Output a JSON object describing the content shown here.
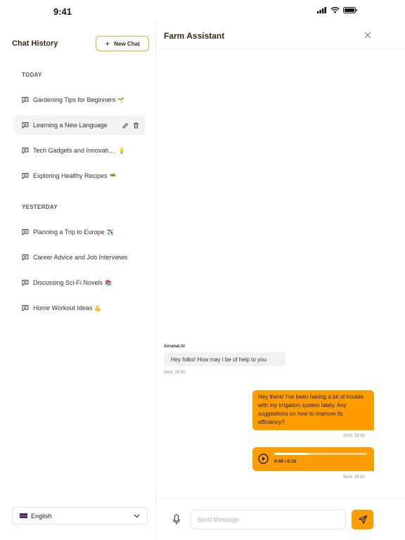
{
  "status_bar": {
    "time": "9:41"
  },
  "sidebar": {
    "title": "Chat History",
    "new_chat_label": "New Chat",
    "sections": [
      {
        "label": "TODAY",
        "items": [
          {
            "label": "Gardening Tips for Beginners",
            "emoji": "🌱"
          },
          {
            "label": "Learning a New Language",
            "emoji": ""
          },
          {
            "label": "Tech Gadgets and Innovations",
            "emoji": "💡"
          },
          {
            "label": "Exploring Healthy Recipes",
            "emoji": "🥗"
          }
        ]
      },
      {
        "label": "YESTERDAY",
        "items": [
          {
            "label": "Planning a Trip to Europe",
            "emoji": "✈️"
          },
          {
            "label": "Career Advice and Job Interviews",
            "emoji": ""
          },
          {
            "label": "Discussing Sci-Fi Novels",
            "emoji": "📚"
          },
          {
            "label": "Home Workout Ideas",
            "emoji": "💪"
          }
        ]
      }
    ],
    "language": "English"
  },
  "chat": {
    "title": "Farm Assistant",
    "messages": [
      {
        "sender": "Airsmat AI",
        "text": "Hey folks! How may i be of help to you",
        "sent": "Sent: 19:30"
      },
      {
        "text": "Hey there! I've been having a bit of trouble with my irrigation system lately. Any suggestions on how to improve its efficiency?",
        "sent": "Sent: 19:30"
      },
      {
        "audio_time": "0:00 / 0:10",
        "progress": 0.37,
        "sent": "Sent: 19:30"
      }
    ],
    "composer": {
      "placeholder": "Send Message"
    }
  },
  "colors": {
    "accent": "#ff9c00",
    "accent_border": "#f5a623",
    "title_text": "#3a2a18"
  }
}
